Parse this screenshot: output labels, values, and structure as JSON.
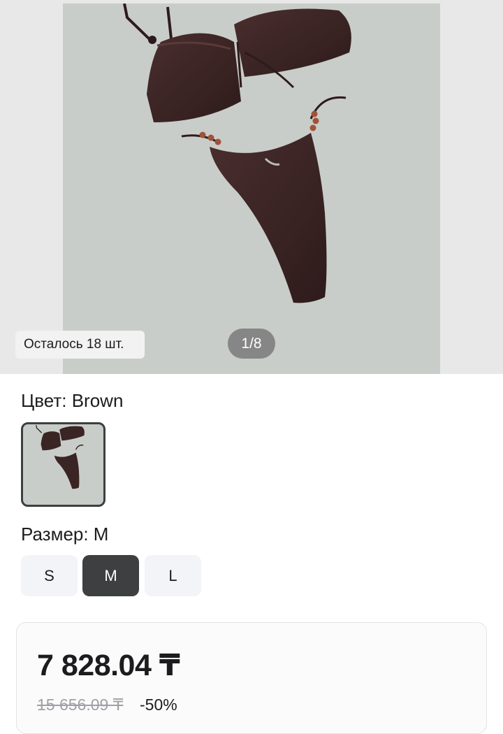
{
  "gallery": {
    "stock_text": "Осталось 18 шт.",
    "page_indicator": "1/8"
  },
  "color": {
    "label": "Цвет: Brown"
  },
  "size": {
    "label": "Размер: M",
    "options": [
      "S",
      "M",
      "L"
    ],
    "selected": "M"
  },
  "price": {
    "current": "7 828.04 ₸",
    "old": "15 656.09 ₸",
    "discount": "-50%"
  },
  "colors": {
    "product": "#3b2424",
    "selected_size_bg": "#3d3f40"
  }
}
